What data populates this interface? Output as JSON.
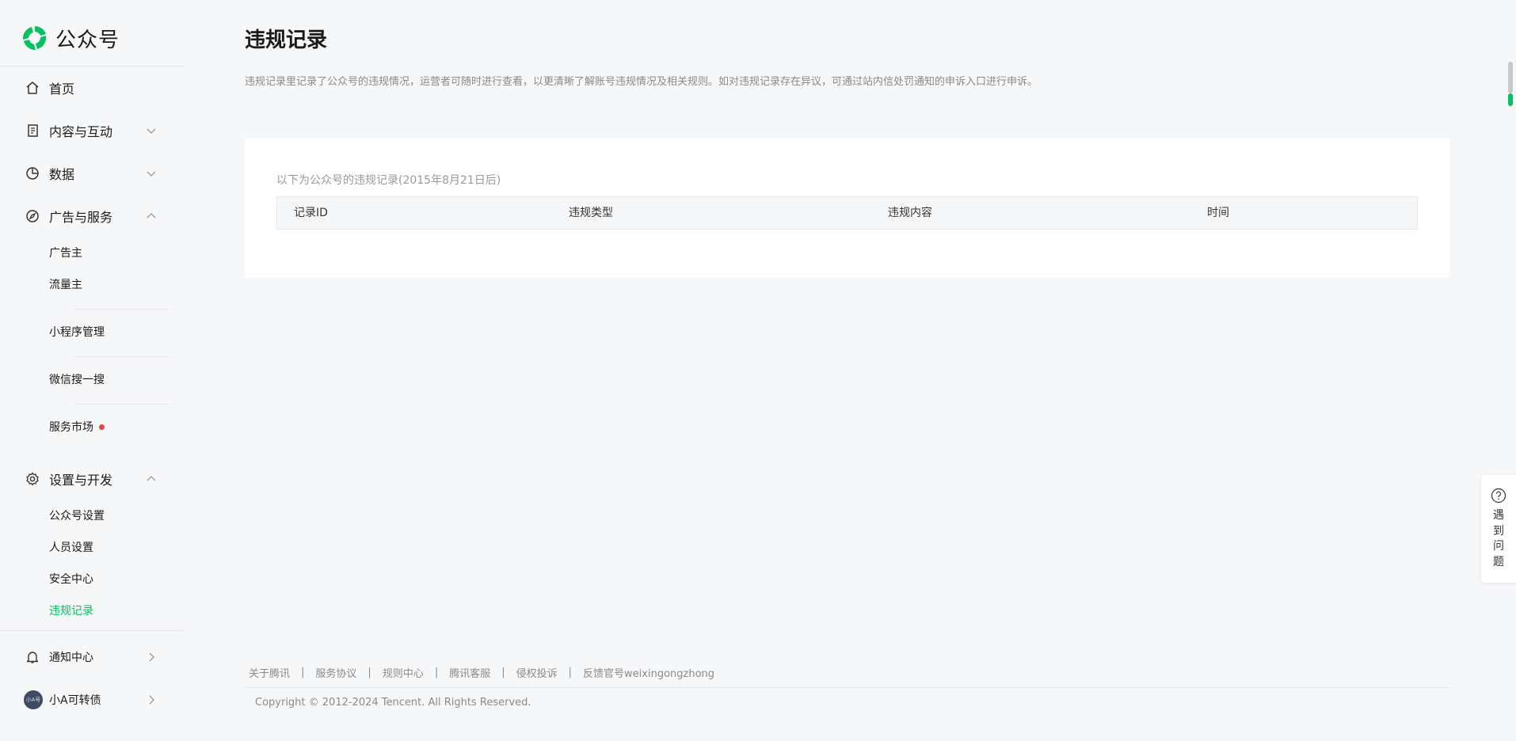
{
  "brand": {
    "name": "公众号",
    "accent": "#07c160"
  },
  "sidebar": {
    "home": "首页",
    "content": "内容与互动",
    "data": "数据",
    "ads": "广告与服务",
    "ads_items": [
      "广告主",
      "流量主"
    ],
    "mini_program": "小程序管理",
    "wechat_search": "微信搜一搜",
    "service_market": "服务市场",
    "settings": "设置与开发",
    "settings_items": [
      "公众号设置",
      "人员设置",
      "安全中心",
      "违规记录"
    ],
    "notifications": "通知中心",
    "account_name": "小A可转债",
    "avatar_text": "小A号"
  },
  "main": {
    "title": "违规记录",
    "description": "违规记录里记录了公众号的违规情况，运营者可随时进行查看，以更清晰了解账号违规情况及相关规则。如对违规记录存在异议，可通过站内信处罚通知的申诉入口进行申诉。",
    "caption": "以下为公众号的违规记录(2015年8月21日后)",
    "columns": [
      "记录ID",
      "违规类型",
      "违规内容",
      "时间"
    ]
  },
  "footer": {
    "links": [
      "关于腾讯",
      "服务协议",
      "规则中心",
      "腾讯客服",
      "侵权投诉",
      "反馈官号weixingongzhong"
    ],
    "separator": "|",
    "copyright": "Copyright © 2012-2024 Tencent. All Rights Reserved."
  },
  "help": {
    "chars": [
      "遇",
      "到",
      "问",
      "题"
    ]
  }
}
